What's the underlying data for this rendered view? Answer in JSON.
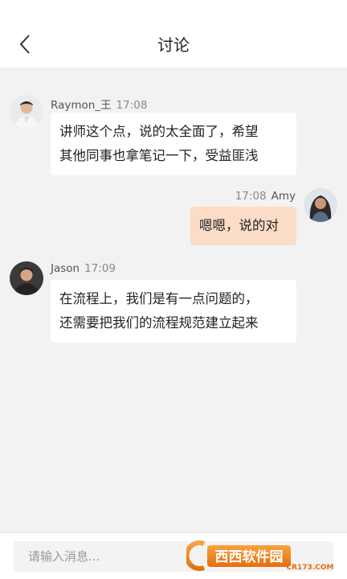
{
  "header": {
    "title": "讨论",
    "back_icon": "chevron-left-icon"
  },
  "messages": [
    {
      "side": "left",
      "sender": "Raymon_王",
      "time": "17:08",
      "lines": [
        "讲师这个点，说的太全面了，希望",
        "其他同事也拿笔记一下，受益匪浅"
      ]
    },
    {
      "side": "right",
      "sender": "Amy",
      "time": "17:08",
      "lines": [
        "嗯嗯，说的对"
      ]
    },
    {
      "side": "left",
      "sender": "Jason",
      "time": "17:09",
      "lines": [
        "在流程上，我们是有一点问题的，",
        "还需要把我们的流程规范建立起来"
      ]
    }
  ],
  "footer": {
    "input_placeholder": "请输入消息...",
    "input_value": ""
  },
  "watermark": {
    "brand": "西西软件园",
    "url": "CR173.COM"
  },
  "colors": {
    "header_bg": "#ffffff",
    "chat_bg": "#f2f2f2",
    "bubble_left": "#ffffff",
    "bubble_right": "#fbdcc7",
    "watermark_orange": "#f08a1c"
  }
}
